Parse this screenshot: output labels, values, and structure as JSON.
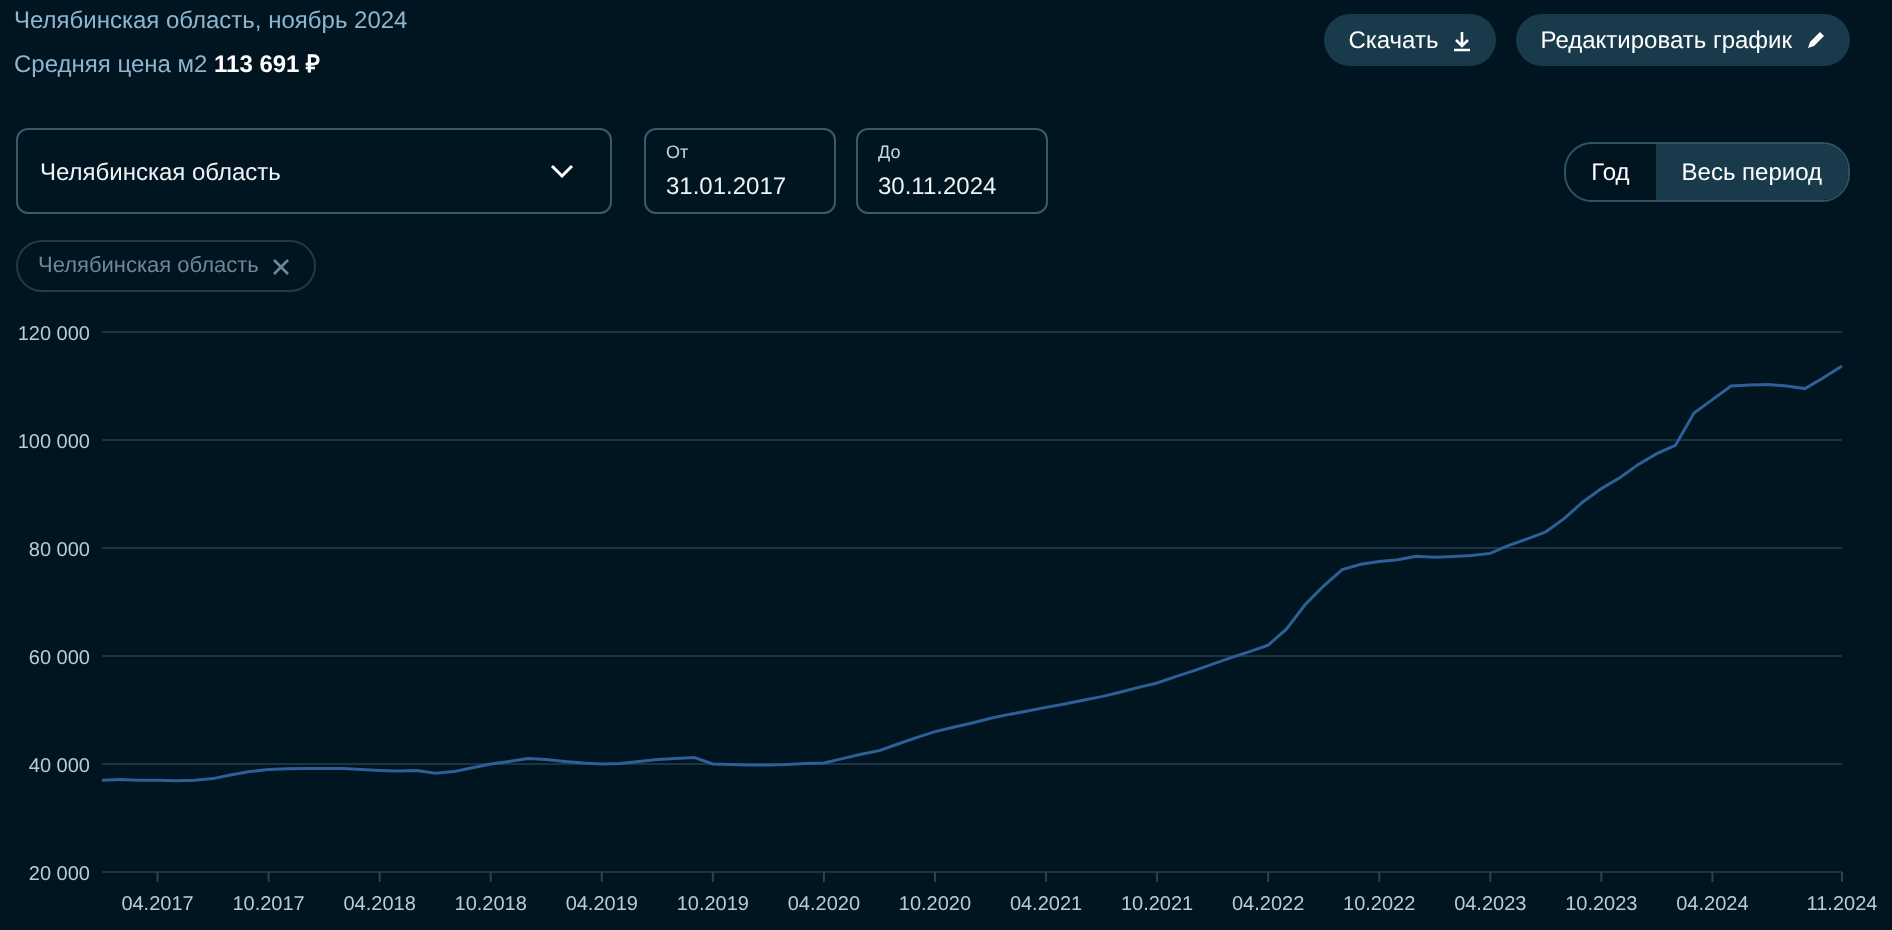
{
  "header": {
    "title": "Челябинская область, ноябрь 2024",
    "price": "Средняя цена м2 **113 691 ₽**"
  },
  "actions": [
    {
      "label": "Скачать",
      "kind": "download"
    },
    {
      "label": "Редактировать график",
      "kind": "edit"
    }
  ],
  "region_select": {
    "value": "Челябинская область"
  },
  "date_from": {
    "label": "От",
    "value": "31.01.2017"
  },
  "date_to": {
    "label": "До",
    "value": "30.11.2024"
  },
  "period_toggle": [
    {
      "label": "Год",
      "selected": false
    },
    {
      "label": "Весь период",
      "selected": true
    }
  ],
  "chips": [
    {
      "label": "Челябинская область"
    }
  ],
  "chart": {
    "chart_data": {
      "type": "line",
      "grid": true,
      "categories": [
        null,
        null,
        null,
        "04.2017",
        null,
        null,
        null,
        null,
        null,
        "10.2017",
        null,
        null,
        null,
        null,
        null,
        "04.2018",
        null,
        null,
        null,
        null,
        null,
        "10.2018",
        null,
        null,
        null,
        null,
        null,
        "04.2019",
        null,
        null,
        null,
        null,
        null,
        "10.2019",
        null,
        null,
        null,
        null,
        null,
        "04.2020",
        null,
        null,
        null,
        null,
        null,
        "10.2020",
        null,
        null,
        null,
        null,
        null,
        "04.2021",
        null,
        null,
        null,
        null,
        null,
        "10.2021",
        null,
        null,
        null,
        null,
        null,
        "04.2022",
        null,
        null,
        null,
        null,
        null,
        "10.2022",
        null,
        null,
        null,
        null,
        null,
        "04.2023",
        null,
        null,
        null,
        null,
        null,
        "10.2023",
        null,
        null,
        null,
        null,
        null,
        "04.2024",
        null,
        null,
        null,
        null,
        null,
        null,
        "11.2024"
      ],
      "ylim": [
        20000,
        120000
      ],
      "yticks": [
        {
          "value": 20000,
          "label": "20 000"
        },
        {
          "value": 40000,
          "label": "40 000"
        },
        {
          "value": 60000,
          "label": "60 000"
        },
        {
          "value": 80000,
          "label": "80 000"
        },
        {
          "value": 100000,
          "label": "100 000"
        },
        {
          "value": 120000,
          "label": "120 000"
        }
      ],
      "series": [
        {
          "color": "#2e5f96",
          "values": [
            37000,
            37100,
            37000,
            37000,
            36900,
            37000,
            37300,
            38000,
            38600,
            39000,
            39100,
            39200,
            39200,
            39200,
            39000,
            38800,
            38700,
            38800,
            38300,
            38600,
            39300,
            40000,
            40500,
            41000,
            40800,
            40500,
            40200,
            40000,
            40100,
            40500,
            40800,
            41000,
            41200,
            40000,
            39900,
            39800,
            39800,
            39900,
            40100,
            40200,
            41000,
            41800,
            42500,
            43700,
            44900,
            46000,
            46800,
            47600,
            48500,
            49200,
            49800,
            50500,
            51100,
            51800,
            52500,
            53300,
            54200,
            55000,
            56200,
            57300,
            58500,
            59700,
            60800,
            62000,
            65000,
            69500,
            73000,
            76000,
            77000,
            77500,
            77800,
            78500,
            78300,
            78400,
            78600,
            79000,
            80500,
            81700,
            83000,
            85500,
            88500,
            91000,
            93000,
            95500,
            97500,
            99000,
            105000,
            107500,
            110000,
            110200,
            110300,
            110000,
            109500,
            111500,
            113700
          ]
        }
      ]
    }
  }
}
